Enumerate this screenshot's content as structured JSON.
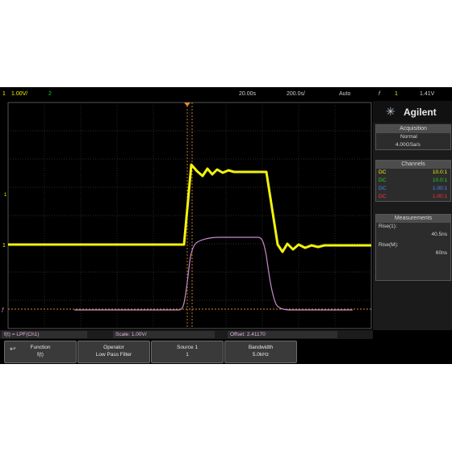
{
  "colors": {
    "ch1": "#f2f20c",
    "ch2": "#22d122",
    "ch3": "#4a86ff",
    "ch4": "#ff3333",
    "math": "#c88bc8",
    "cursor": "#d98a32",
    "grid": "#3a3a3a"
  },
  "topbar": {
    "ch1_num": "1",
    "ch1_scale": "1.00V/",
    "ch2_num": "2",
    "delay": "20.00s",
    "timebase": "200.0s/",
    "mode": "Auto",
    "trig_icon": "f",
    "trig_src": "1",
    "trig_level": "1.41V"
  },
  "markers": {
    "ch1": "1",
    "ch1_alt": "1",
    "math": "f"
  },
  "side": {
    "brand": "Agilent",
    "acquisition": {
      "title": "Acquisition",
      "mode": "Normal",
      "rate": "4.00GSa/s"
    },
    "channels": {
      "title": "Channels",
      "rows": [
        {
          "coupling": "DC",
          "ratio": "10.0:1",
          "color": "#f2f20c"
        },
        {
          "coupling": "DC",
          "ratio": "10.0:1",
          "color": "#22d122"
        },
        {
          "coupling": "DC",
          "ratio": "1.00:1",
          "color": "#4a86ff"
        },
        {
          "coupling": "DC",
          "ratio": "1.00:1",
          "color": "#ff3333"
        }
      ]
    },
    "measurements": {
      "title": "Measurements",
      "m1_label": "Rise(1):",
      "m1_value": "40.5ns",
      "m2_label": "Rise(M):",
      "m2_value": "60ns"
    }
  },
  "mathbar": {
    "func": "f(t) = LPF(Ch1)",
    "scale": "Scale: 1.00V/",
    "offset": "Offset: 2.41170"
  },
  "softkeys": [
    {
      "line1": "Function",
      "line2": "f(t)"
    },
    {
      "line1": "Operator",
      "line2": "Low Pass Filter"
    },
    {
      "line1": "Source 1",
      "line2": "1"
    },
    {
      "line1": "Bandwidth",
      "line2": "5.0kHz"
    }
  ]
}
